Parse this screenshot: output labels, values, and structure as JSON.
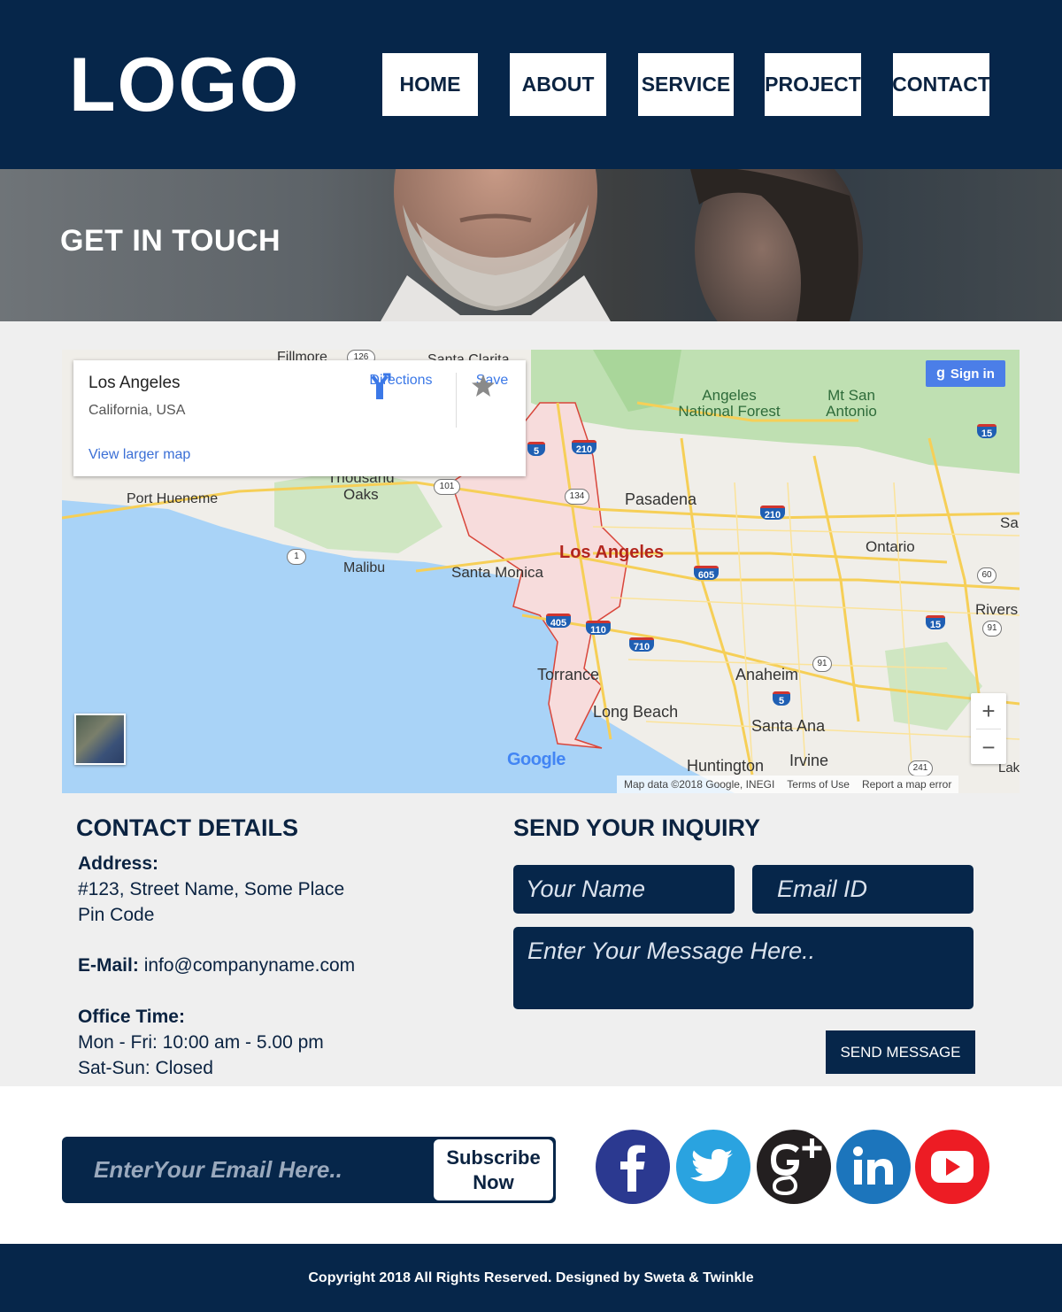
{
  "header": {
    "logo": "LOGO",
    "nav": [
      {
        "label": "HOME"
      },
      {
        "label": "ABOUT"
      },
      {
        "label": "SERVICE"
      },
      {
        "label": "PROJECT"
      },
      {
        "label": "CONTACT"
      }
    ]
  },
  "hero": {
    "title": "GET IN TOUCH"
  },
  "map": {
    "card": {
      "place": "Los Angeles",
      "region": "California, USA",
      "directions": "Directions",
      "save": "Save",
      "larger_map": "View larger map"
    },
    "sign_in": "Sign in",
    "google": "Google",
    "attribution": {
      "data": "Map data ©2018 Google, INEGI",
      "terms": "Terms of Use",
      "report": "Report a map error"
    },
    "zoom_in": "+",
    "zoom_out": "−",
    "labels": {
      "fillmore": "Fillmore",
      "santa_clarita": "Santa Clarita",
      "angeles_nf_1": "Angeles",
      "angeles_nf_2": "National Forest",
      "mt_san_1": "Mt San",
      "mt_san_2": "Antonio",
      "thousand_oaks_1": "Thousand",
      "thousand_oaks_2": "Oaks",
      "port_hueneme": "Port Hueneme",
      "pasadena": "Pasadena",
      "los_angeles": "Los Angeles",
      "malibu": "Malibu",
      "santa_monica": "Santa Monica",
      "ontario": "Ontario",
      "torrance": "Torrance",
      "anaheim": "Anaheim",
      "long_beach": "Long Beach",
      "santa_ana": "Santa Ana",
      "huntington": "Huntington",
      "irvine": "Irvine",
      "riverside": "Rivers",
      "san_b": "Sa",
      "lake": "Lak"
    },
    "highways": [
      "126",
      "5",
      "210",
      "101",
      "134",
      "210",
      "605",
      "405",
      "110",
      "710",
      "5",
      "15",
      "1",
      "60",
      "15",
      "91",
      "91",
      "241"
    ]
  },
  "contact": {
    "title": "CONTACT DETAILS",
    "address_label": "Address:",
    "address_line1": "#123, Street Name, Some Place",
    "address_line2": "Pin Code",
    "email_label": "E-Mail:",
    "email_value": "info@companyname.com",
    "office_label": "Office Time:",
    "office_line1": "Mon - Fri: 10:00 am - 5.00 pm",
    "office_line2": "Sat-Sun: Closed"
  },
  "inquiry": {
    "title": "SEND YOUR INQUIRY",
    "name_placeholder": "Your Name",
    "email_placeholder": "Email ID",
    "message_placeholder": "Enter Your Message Here..",
    "send_label": "SEND MESSAGE"
  },
  "subscribe": {
    "placeholder": "EnterYour Email Here..",
    "button_line1": "Subscribe",
    "button_line2": "Now"
  },
  "social": [
    {
      "name": "facebook-icon",
      "color": "#2b3990"
    },
    {
      "name": "twitter-icon",
      "color": "#2aa3e0"
    },
    {
      "name": "google-plus-icon",
      "color": "#231f20"
    },
    {
      "name": "linkedin-icon",
      "color": "#1c75bc"
    },
    {
      "name": "youtube-icon",
      "color": "#ed1c24"
    }
  ],
  "footer": {
    "copyright": "Copyright 2018 All Rights Reserved. Designed by Sweta & Twinkle"
  },
  "colors": {
    "navy": "#06264a",
    "band": "#efefef",
    "accent_link": "#3b78e7"
  }
}
